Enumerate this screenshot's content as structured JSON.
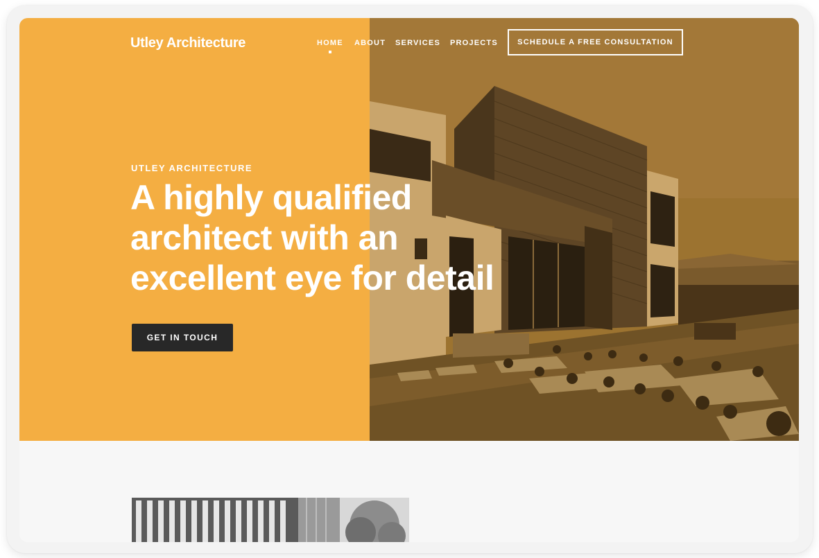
{
  "nav": {
    "logo": "Utley Architecture",
    "items": [
      {
        "label": "HOME",
        "active": true
      },
      {
        "label": "ABOUT",
        "active": false
      },
      {
        "label": "SERVICES",
        "active": false
      },
      {
        "label": "PROJECTS",
        "active": false
      }
    ],
    "cta": "SCHEDULE A FREE CONSULTATION"
  },
  "hero": {
    "eyebrow": "UTLEY ARCHITECTURE",
    "headline_lines": [
      "A highly qualified",
      "architect with an",
      "excellent eye for detail"
    ],
    "button": "GET IN TOUCH",
    "image": "modern-house-photo"
  },
  "section": {
    "image": "building-facade-photo"
  },
  "colors": {
    "accent": "#f4ae42",
    "dark_button": "#282828",
    "text_on_accent": "#ffffff",
    "page_background": "#f7f7f7"
  }
}
